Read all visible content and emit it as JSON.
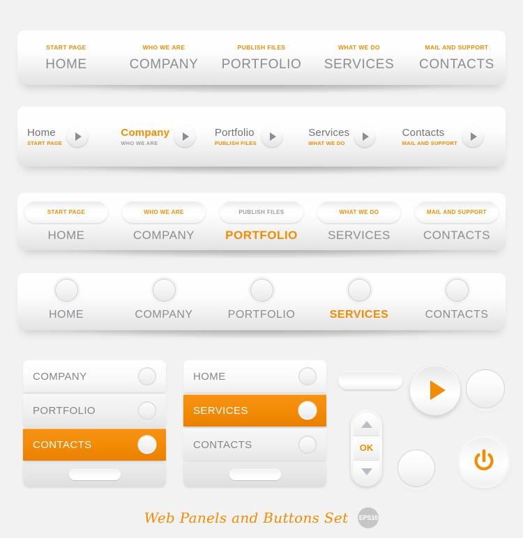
{
  "page": {
    "background": "#f2f2f2",
    "accent_orange": "#f28c00",
    "text_gray": "#8a8d91"
  },
  "panel1": {
    "items": [
      {
        "sub": "START PAGE",
        "main": "HOME"
      },
      {
        "sub": "WHO WE ARE",
        "main": "COMPANY"
      },
      {
        "sub": "PUBLISH FILES",
        "main": "PORTFOLIO"
      },
      {
        "sub": "WHAT WE DO",
        "main": "SERVICES"
      },
      {
        "sub": "MAIL AND SUPPORT",
        "main": "CONTACTS"
      }
    ]
  },
  "panel2": {
    "items": [
      {
        "main": "Home",
        "sub": "START PAGE"
      },
      {
        "main": "Company",
        "sub": "WHO WE ARE"
      },
      {
        "main": "Portfolio",
        "sub": "PUBLISH FILES"
      },
      {
        "main": "Services",
        "sub": "WHAT WE DO"
      },
      {
        "main": "Contacts",
        "sub": "MAIL AND SUPPORT"
      }
    ]
  },
  "panel3": {
    "items": [
      {
        "sub": "START PAGE",
        "main": "HOME"
      },
      {
        "sub": "WHO WE ARE",
        "main": "COMPANY"
      },
      {
        "sub": "PUBLISH FILES",
        "main": "PORTFOLIO"
      },
      {
        "sub": "WHAT WE DO",
        "main": "SERVICES"
      },
      {
        "sub": "MAIL AND SUPPORT",
        "main": "CONTACTS"
      }
    ]
  },
  "panel4": {
    "items": [
      {
        "main": "HOME"
      },
      {
        "main": "COMPANY"
      },
      {
        "main": "PORTFOLIO"
      },
      {
        "main": "SERVICES"
      },
      {
        "main": "CONTACTS"
      }
    ]
  },
  "vmenu1": {
    "items": [
      {
        "label": "COMPANY"
      },
      {
        "label": "PORTFOLIO"
      },
      {
        "label": "CONTACTS"
      }
    ]
  },
  "vmenu2": {
    "items": [
      {
        "label": "HOME"
      },
      {
        "label": "SERVICES"
      },
      {
        "label": "CONTACTS"
      }
    ]
  },
  "stepper": {
    "ok_label": "OK"
  },
  "footer": {
    "title": "Web Panels and Buttons Set",
    "badge": "EPS10"
  }
}
